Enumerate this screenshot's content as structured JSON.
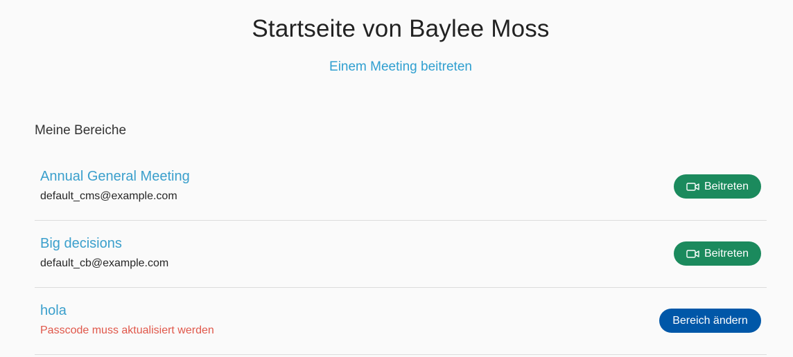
{
  "page": {
    "title": "Startseite von Baylee Moss",
    "join_link": "Einem Meeting beitreten",
    "section_heading": "Meine Bereiche"
  },
  "spaces": [
    {
      "name": "Annual General Meeting",
      "subtitle": "default_cms@example.com",
      "subtitle_is_warning": false,
      "button_label": "Beitreten",
      "button_icon": "video-camera-icon"
    },
    {
      "name": "Big decisions",
      "subtitle": "default_cb@example.com",
      "subtitle_is_warning": false,
      "button_label": "Beitreten",
      "button_icon": "video-camera-icon"
    },
    {
      "name": "hola",
      "subtitle": "Passcode muss aktualisiert werden",
      "subtitle_is_warning": true,
      "button_label": "Bereich ändern",
      "button_icon": ""
    }
  ],
  "colors": {
    "link": "#2f9fd0",
    "join_button": "#1b8a5d",
    "change_button": "#0057a8",
    "warning_text": "#e0574a"
  }
}
